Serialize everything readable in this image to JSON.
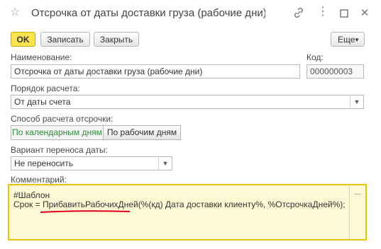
{
  "window": {
    "title": "Отсрочка от даты доставки груза (рабочие дни) (Ус...",
    "icons": [
      "star-icon",
      "link-icon",
      "more-icon",
      "maximize-icon",
      "close-icon"
    ]
  },
  "toolbar": {
    "ok_label": "OK",
    "save_label": "Записать",
    "close_label": "Закрыть",
    "more_label": "Еще"
  },
  "form": {
    "name_label": "Наименование:",
    "name_value": "Отсрочка от даты доставки груза (рабочие дни)",
    "code_label": "Код:",
    "code_value": "000000003",
    "calc_order_label": "Порядок расчета:",
    "calc_order_value": "От даты счета",
    "delay_method_label": "Способ расчета отсрочки:",
    "delay_options": [
      "По календарным дням",
      "По рабочим дням"
    ],
    "delay_selected": "По календарным дням",
    "transfer_label": "Вариант переноса даты:",
    "transfer_value": "Не переносить",
    "comment_label": "Комментарий:",
    "comment_line1": "#Шаблон",
    "comment_line2": "Срок = ПрибавитьРабочихДней(%(кд) Дата доставки клиенту%, %ОтсрочкаДней%);",
    "comment_more": "..."
  },
  "colors": {
    "ok_button": "#fbe34c",
    "comment_border": "#f2c000",
    "comment_bg": "#fdf9d5",
    "underline": "#e0001a",
    "selected_option_text": "#2f8f3a"
  }
}
